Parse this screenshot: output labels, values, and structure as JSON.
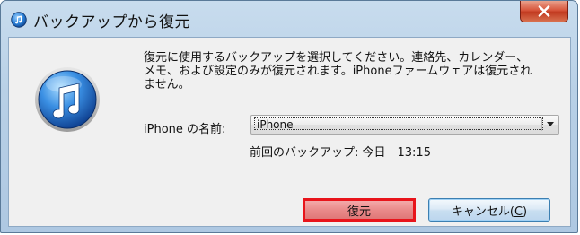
{
  "window": {
    "title": "バックアップから復元"
  },
  "dialog": {
    "message": "復元に使用するバックアップを選択してください。連絡先、カレンダー、\nメモ、および設定のみが復元されます。iPhoneファームウェアは復元され\nません。",
    "device_label": "iPhone の名前:",
    "device_selected": "iPhone",
    "last_backup": "前回のバックアップ: 今日　13:15",
    "restore_label": "復元",
    "cancel_label_prefix": "キャンセル(",
    "cancel_mnemonic": "C",
    "cancel_label_suffix": ")"
  },
  "icons": {
    "title": "itunes-icon",
    "main": "itunes-icon",
    "close": "close-icon",
    "dropdown": "chevron-down-icon"
  },
  "colors": {
    "highlight_border": "#e8141b",
    "close_red": "#c13a20",
    "itunes_blue": "#1f67c9"
  }
}
